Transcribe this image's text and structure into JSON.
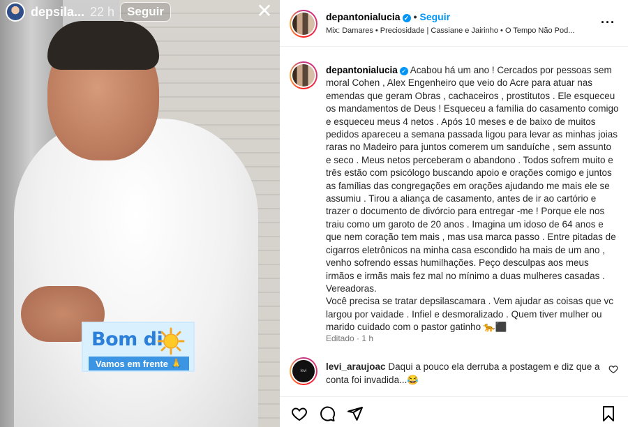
{
  "story": {
    "username": "depsila...",
    "time": "22 h",
    "follow_label": "Seguir",
    "close_icon": "close-icon",
    "sticker": {
      "title": "Bom dia",
      "subtitle": "Vamos em frente"
    }
  },
  "post": {
    "username": "depantonialucia",
    "follow_label": "Seguir",
    "music": "Mix: Damares • Preciosidade | Cassiane e Jairinho • O Tempo Não Pod...",
    "caption_user": "depantonialucia",
    "caption": "Acabou há um ano ! Cercados por pessoas sem moral Cohen , Alex Engenheiro que veio do Acre para atuar nas emendas que geram Obras , cachaceiros , prostitutos . Ele esqueceu os mandamentos de Deus ! Esqueceu a família do casamento comigo e esqueceu meus 4 netos . Após 10 meses e de baixo de muitos pedidos apareceu a semana passada ligou para levar as minhas joias raras no Madeiro para juntos comerem um sanduíche , sem assunto e seco . Meus netos perceberam o abandono . Todos sofrem muito e três estão com psicólogo buscando apoio e orações comigo e juntos as famílias das congregações em orações ajudando me mais ele se assumiu . Tirou a aliança de casamento, antes de ir ao cartório e trazer o documento de divórcio para entregar -me ! Porque ele nos traiu como um garoto de 20 anos . Imagina um idoso de 64 anos e que nem coração tem mais , mas usa marca passo . Entre pitadas de cigarros eletrônicos na minha casa escondido ha mais de um ano , venho sofrendo essas humilhações. Peço desculpas aos meus irmãos e irmãs mais fez mal no mínimo a duas mulheres casadas . Vereadoras.\nVocê precisa se tratar depsilascamara . Vem ajudar as coisas que vc largou por vaidade . Infiel e desmoralizado . Quem tiver mulher ou marido cuidado com o pastor gatinho 🐆⬛",
    "edited": "Editado · 1 h"
  },
  "comment": {
    "username": "levi_araujoac",
    "text": "Daqui a pouco ela derruba a postagem e diz que a conta foi invadida...😂"
  },
  "actions": [
    "heart-icon",
    "comment-icon",
    "share-icon",
    "bookmark-icon"
  ]
}
